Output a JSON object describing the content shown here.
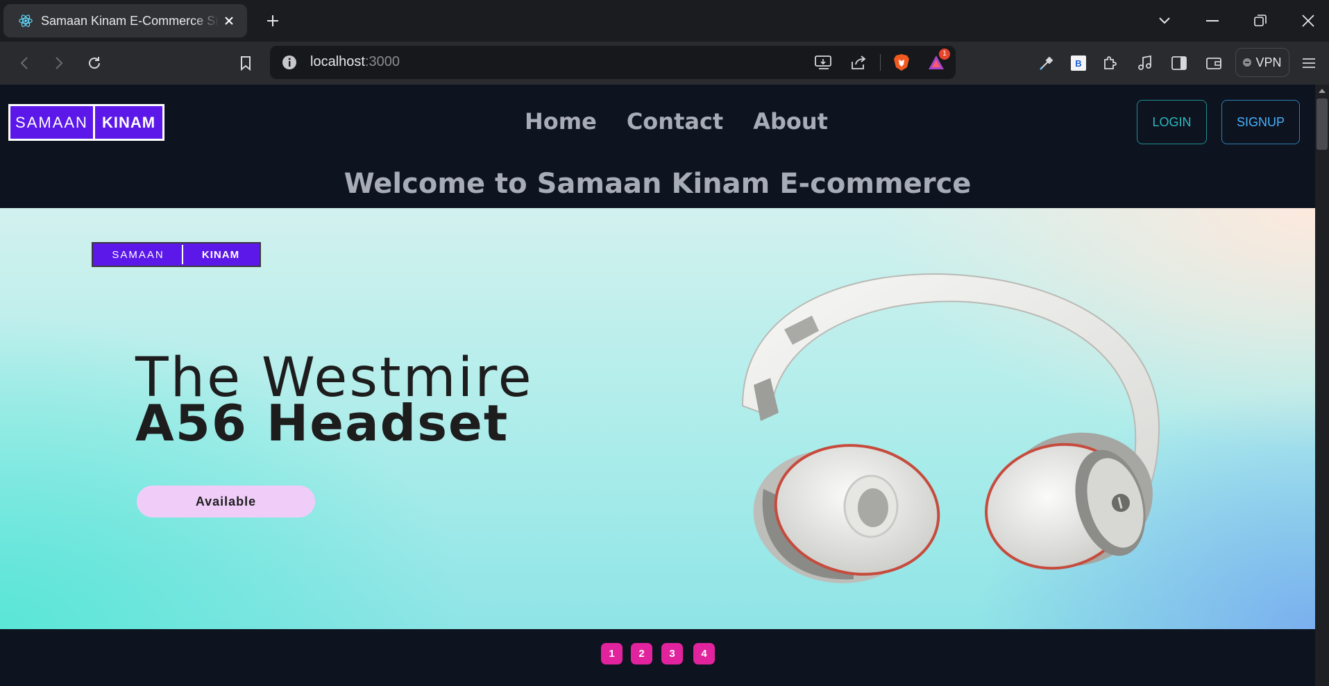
{
  "browser": {
    "tab_title": "Samaan Kinam E-Commerce Site",
    "url_host": "localhost",
    "url_port": ":3000",
    "notification_badge": "1",
    "vpn_label": "VPN",
    "extension_badge_letter": "B"
  },
  "header": {
    "logo_left": "SAMAAN",
    "logo_right": "KINAM",
    "nav": [
      "Home",
      "Contact",
      "About"
    ],
    "login_label": "LOGIN",
    "signup_label": "SIGNUP"
  },
  "welcome": "Welcome to Samaan Kinam E-commerce",
  "banner": {
    "logo_left": "SAMAAN",
    "logo_right": "KINAM",
    "headline_line1": "The Westmire",
    "headline_line2": "A56 Headset",
    "button_label": "Available"
  },
  "pager": [
    "1",
    "2",
    "3",
    "4"
  ],
  "colors": {
    "brand_purple": "#5b18e8",
    "pager_pink": "#e1239e",
    "login_teal": "#2eb9bd",
    "signup_blue": "#46b3ff",
    "page_bg": "#0e1320"
  }
}
